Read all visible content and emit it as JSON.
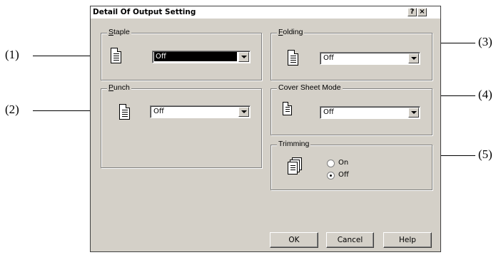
{
  "dialog": {
    "title": "Detail Of Output Setting",
    "help_button": "?",
    "close_button": "×"
  },
  "callouts": [
    "(1)",
    "(2)",
    "(3)",
    "(4)",
    "(5)"
  ],
  "staple": {
    "label_mnemonic": "S",
    "label_rest": "taple",
    "value": "Off",
    "icon": "document-icon"
  },
  "punch": {
    "label_mnemonic": "P",
    "label_rest": "unch",
    "value": "Off",
    "icon": "document-icon"
  },
  "folding": {
    "label_mnemonic": "F",
    "label_rest": "olding",
    "value": "Off",
    "icon": "document-icon"
  },
  "cover_sheet": {
    "label": "Cover Sheet Mode",
    "value": "Off",
    "icon": "document-icon"
  },
  "trimming": {
    "label": "Trimming",
    "on_label": "On",
    "off_label": "Off",
    "selected": "Off",
    "icon": "stacked-pages-icon"
  },
  "buttons": {
    "ok": "OK",
    "cancel": "Cancel",
    "help": "Help"
  }
}
